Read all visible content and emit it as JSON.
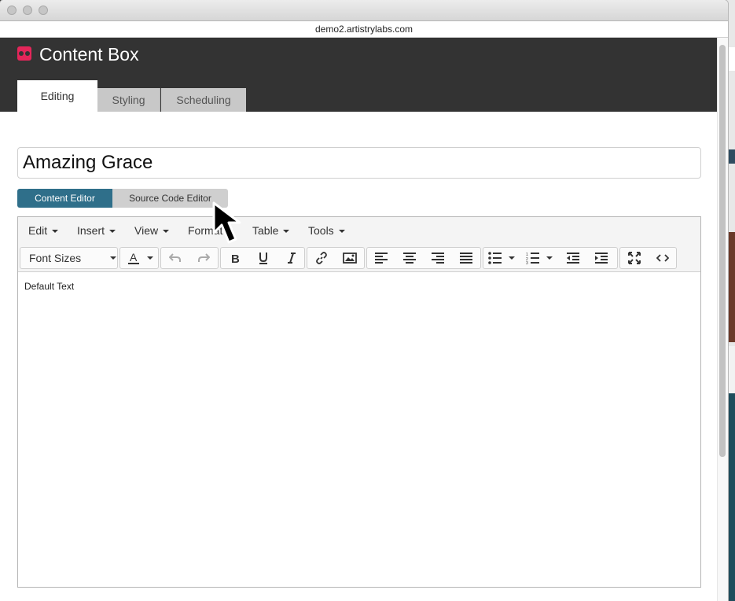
{
  "browser": {
    "url": "demo2.artistrylabs.com"
  },
  "app": {
    "title": "Content Box"
  },
  "tabs": [
    {
      "label": "Editing",
      "active": true
    },
    {
      "label": "Styling",
      "active": false
    },
    {
      "label": "Scheduling",
      "active": false
    }
  ],
  "title_field": {
    "value": "Amazing Grace"
  },
  "editor_modes": [
    {
      "label": "Content Editor",
      "active": true
    },
    {
      "label": "Source Code Editor",
      "active": false
    }
  ],
  "menu": [
    "Edit",
    "Insert",
    "View",
    "Format",
    "Table",
    "Tools"
  ],
  "toolbar": {
    "font_sizes_label": "Font Sizes",
    "buttons": [
      "text-color-icon",
      "undo-icon",
      "redo-icon",
      "bold-icon",
      "underline-icon",
      "italic-icon",
      "link-icon",
      "image-icon",
      "align-left-icon",
      "align-center-icon",
      "align-right-icon",
      "align-justify-icon",
      "bullet-list-icon",
      "numbered-list-icon",
      "outdent-icon",
      "indent-icon",
      "fullscreen-icon",
      "source-code-icon"
    ]
  },
  "editor_body": {
    "text": "Default Text"
  },
  "colors": {
    "header_bg": "#333333",
    "accent": "#e4265a",
    "active_mode": "#2f6f8a"
  }
}
